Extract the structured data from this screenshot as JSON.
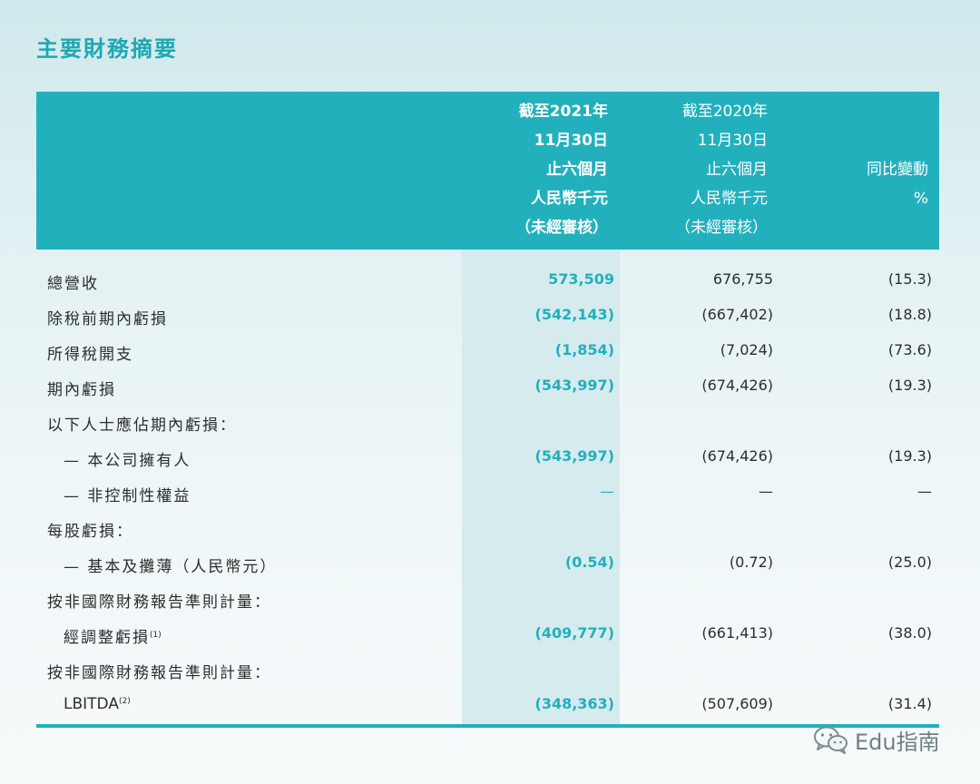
{
  "page": {
    "title": "主要財務摘要"
  },
  "header": {
    "col_2021": [
      "截至2021年",
      "11月30日",
      "止六個月",
      "人民幣千元",
      "（未經審核）"
    ],
    "col_2020": [
      "截至2020年",
      "11月30日",
      "止六個月",
      "人民幣千元",
      "（未經審核）"
    ],
    "col_change": [
      "",
      "",
      "同比變動",
      "%",
      ""
    ]
  },
  "rows": [
    {
      "label": "總營收",
      "note": "",
      "v2021": "573,509",
      "v2020": "676,755",
      "change": "(15.3)"
    },
    {
      "label": "除稅前期內虧損",
      "note": "",
      "v2021": "(542,143)",
      "v2020": "(667,402)",
      "change": "(18.8)"
    },
    {
      "label": "所得稅開支",
      "note": "",
      "v2021": "(1,854)",
      "v2020": "(7,024)",
      "change": "(73.6)"
    },
    {
      "label": "期內虧損",
      "note": "",
      "v2021": "(543,997)",
      "v2020": "(674,426)",
      "change": "(19.3)"
    },
    {
      "label": "以下人士應佔期內虧損：",
      "note": "",
      "v2021": "",
      "v2020": "",
      "change": ""
    },
    {
      "label": "— 本公司擁有人",
      "note": "",
      "v2021": "(543,997)",
      "v2020": "(674,426)",
      "change": "(19.3)"
    },
    {
      "label": "— 非控制性權益",
      "note": "",
      "v2021": "—",
      "v2020": "—",
      "change": "—"
    },
    {
      "label": "每股虧損：",
      "note": "",
      "v2021": "",
      "v2020": "",
      "change": ""
    },
    {
      "label": "— 基本及攤薄（人民幣元）",
      "note": "",
      "v2021": "(0.54)",
      "v2020": "(0.72)",
      "change": "(25.0)"
    },
    {
      "label": "按非國際財務報告準則計量：",
      "note": "",
      "v2021": "",
      "v2020": "",
      "change": ""
    },
    {
      "label": "經調整虧損",
      "note": "(1)",
      "v2021": "(409,777)",
      "v2020": "(661,413)",
      "change": "(38.0)"
    },
    {
      "label": "按非國際財務報告準則計量：",
      "note": "",
      "v2021": "",
      "v2020": "",
      "change": ""
    },
    {
      "label": "LBITDA",
      "note": "(2)",
      "v2021": "(348,363)",
      "v2020": "(507,609)",
      "change": "(31.4)"
    }
  ],
  "watermark": {
    "text": "Edu指南",
    "icon": "wechat-icon"
  }
}
